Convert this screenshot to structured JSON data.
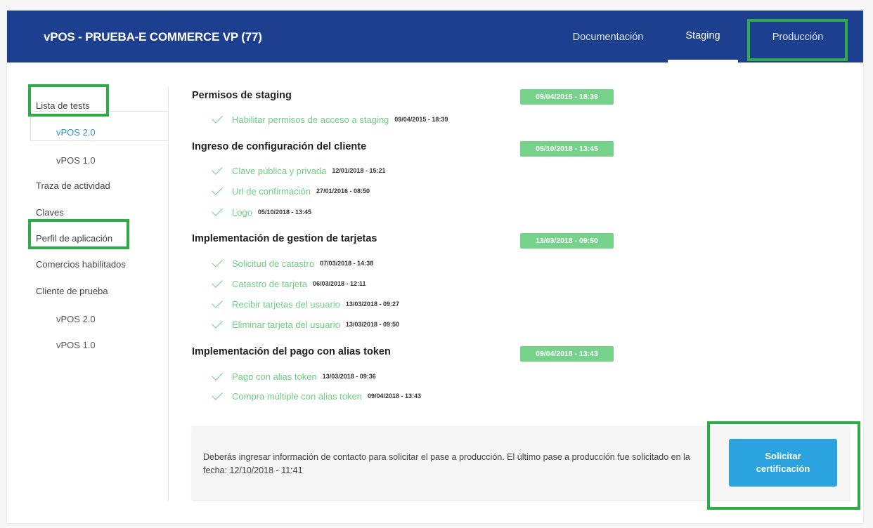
{
  "header": {
    "title": "vPOS - PRUEBA-E COMMERCE VP (77)",
    "tabs": [
      {
        "label": "Documentación"
      },
      {
        "label": "Staging"
      },
      {
        "label": "Producción"
      }
    ],
    "active_tab": "Staging"
  },
  "sidebar": {
    "items": [
      {
        "label": "Lista de tests"
      },
      {
        "label": "vPOS 2.0"
      },
      {
        "label": "vPOS 1.0"
      },
      {
        "label": "Traza de actividad"
      },
      {
        "label": "Claves"
      },
      {
        "label": "Perfil de aplicación"
      },
      {
        "label": "Comercios habilitados"
      },
      {
        "label": "Cliente de prueba"
      },
      {
        "label": "vPOS 2.0"
      },
      {
        "label": "vPOS 1.0"
      }
    ]
  },
  "sections": [
    {
      "title": "Permisos de staging",
      "date": "09/04/2015 - 18:39",
      "items": [
        {
          "label": "Habilitar permisos de acceso a staging",
          "date": "09/04/2015 - 18:39"
        }
      ]
    },
    {
      "title": "Ingreso de configuración del cliente",
      "date": "05/10/2018 - 13:45",
      "items": [
        {
          "label": "Clave pública y privada",
          "date": "12/01/2018 - 15:21"
        },
        {
          "label": "Url de confirmación",
          "date": "27/01/2016 - 08:50"
        },
        {
          "label": "Logo",
          "date": "05/10/2018 - 13:45"
        }
      ]
    },
    {
      "title": "Implementación de gestion de tarjetas",
      "date": "13/03/2018 - 09:50",
      "items": [
        {
          "label": "Solicitud de catastro",
          "date": "07/03/2018 - 14:38"
        },
        {
          "label": "Catastro de tarjeta",
          "date": "06/03/2018 - 12:11"
        },
        {
          "label": "Recibir tarjetas del usuario",
          "date": "13/03/2018 - 09:27"
        },
        {
          "label": "Eliminar tarjeta del usuario",
          "date": "13/03/2018 - 09:50"
        }
      ]
    },
    {
      "title": "Implementación del pago con alias token",
      "date": "09/04/2018 - 13:43",
      "items": [
        {
          "label": "Pago con alias token",
          "date": "13/03/2018 - 09:36"
        },
        {
          "label": "Compra múltiple con alias token",
          "date": "09/04/2018 - 13:43"
        }
      ]
    }
  ],
  "footer": {
    "message": "Deberás ingresar información de contacto para solicitar el pase a producción. El último pase a producción fue solicitado en la fecha: 12/10/2018 - 11:41",
    "button_label": "Solicitar certificación"
  },
  "colors": {
    "header_bg": "#1d3f8f",
    "success_green": "#6ccf82",
    "badge_green": "#76d28b",
    "highlight_green": "#2eab48",
    "button_blue": "#2aa3de",
    "link_blue": "#2f8fd8"
  }
}
